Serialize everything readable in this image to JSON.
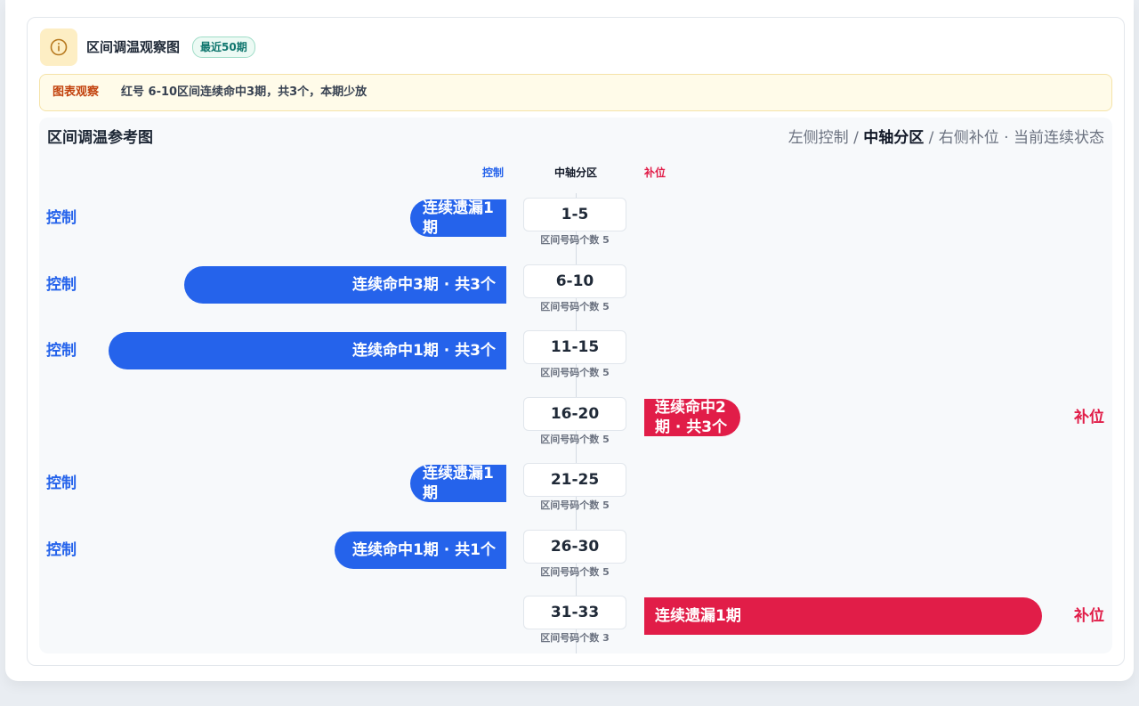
{
  "header": {
    "title": "区间调温观察图",
    "badge": "最近50期",
    "icon": "info-icon"
  },
  "notice": {
    "label": "图表观察",
    "text": "红号 6-10区间连续命中3期，共3个，本期少放"
  },
  "panel": {
    "title": "区间调温参考图",
    "legend": {
      "left": "左侧控制",
      "sep1": " / ",
      "center": "中轴分区",
      "sep2": " / ",
      "right": "右侧补位",
      "dot": " · ",
      "status": "当前连续状态"
    }
  },
  "columns": {
    "left": "控制",
    "center": "中轴分区",
    "right": "补位"
  },
  "colors": {
    "control": "#2563eb",
    "fill": "#e11d48",
    "accent": "#0f766e"
  },
  "chart_data": {
    "type": "bar",
    "orientation": "diverging-horizontal",
    "categories": [
      "1-5",
      "6-10",
      "11-15",
      "16-20",
      "21-25",
      "26-30",
      "31-33"
    ],
    "rows": [
      {
        "zone": "1-5",
        "count_label": "区间号码个数 5",
        "count": 5,
        "side": "left",
        "side_label": "控制",
        "bar_label": "连续遗漏1期",
        "magnitude": 0.23
      },
      {
        "zone": "6-10",
        "count_label": "区间号码个数 5",
        "count": 5,
        "side": "left",
        "side_label": "控制",
        "bar_label": "连续命中3期 · 共3个",
        "magnitude": 0.77
      },
      {
        "zone": "11-15",
        "count_label": "区间号码个数 5",
        "count": 5,
        "side": "left",
        "side_label": "控制",
        "bar_label": "连续命中1期 · 共3个",
        "magnitude": 0.95
      },
      {
        "zone": "16-20",
        "count_label": "区间号码个数 5",
        "count": 5,
        "side": "right",
        "side_label": "补位",
        "bar_label": "连续命中2期 · 共3个",
        "magnitude": 0.23
      },
      {
        "zone": "21-25",
        "count_label": "区间号码个数 5",
        "count": 5,
        "side": "left",
        "side_label": "控制",
        "bar_label": "连续遗漏1期",
        "magnitude": 0.23
      },
      {
        "zone": "26-30",
        "count_label": "区间号码个数 5",
        "count": 5,
        "side": "left",
        "side_label": "控制",
        "bar_label": "连续命中1期 · 共1个",
        "magnitude": 0.41
      },
      {
        "zone": "31-33",
        "count_label": "区间号码个数 3",
        "count": 3,
        "side": "right",
        "side_label": "补位",
        "bar_label": "连续遗漏1期",
        "magnitude": 0.95
      }
    ]
  }
}
